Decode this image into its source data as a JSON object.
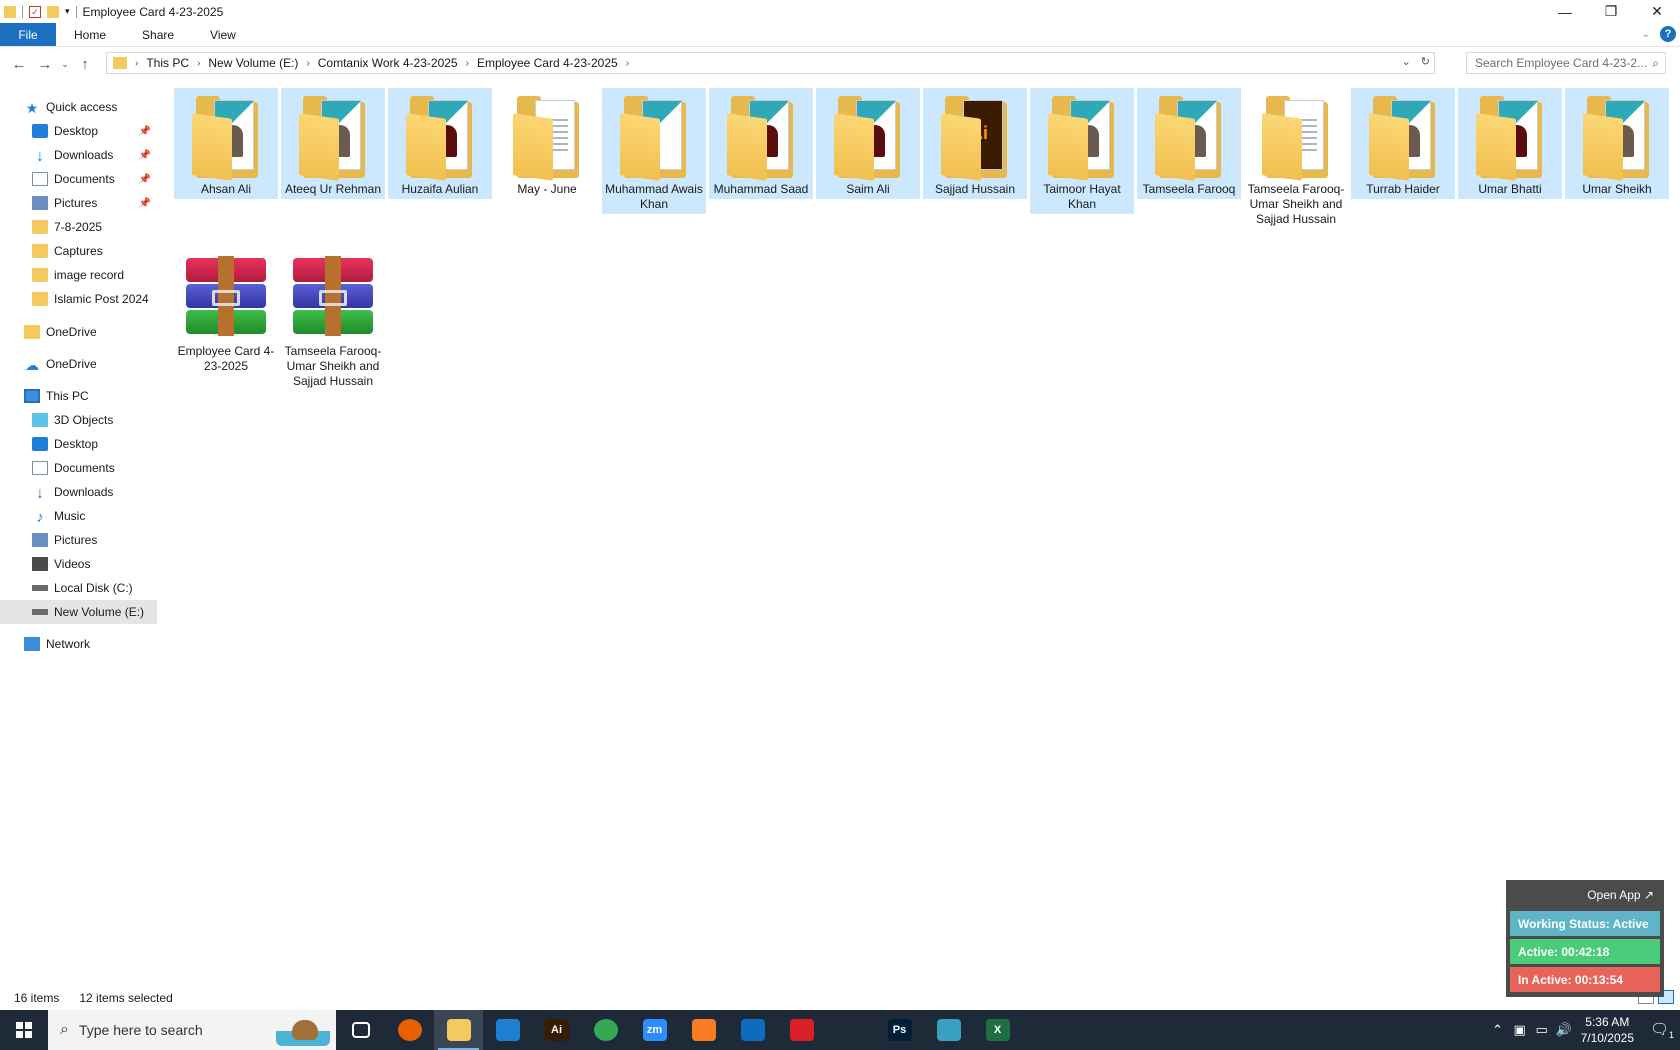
{
  "window": {
    "title": "Employee Card 4-23-2025",
    "minimize_glyph": "—",
    "restore_glyph": "❐",
    "close_glyph": "✕"
  },
  "ribbon": {
    "tabs": [
      "File",
      "Home",
      "Share",
      "View"
    ],
    "help": "?"
  },
  "address": {
    "crumbs": [
      "This PC",
      "New Volume (E:)",
      "Comtanix Work 4-23-2025",
      "Employee Card 4-23-2025"
    ],
    "search_placeholder": "Search Employee Card 4-23-2..."
  },
  "nav": {
    "quick_access": "Quick access",
    "quick_items": [
      "Desktop",
      "Downloads",
      "Documents",
      "Pictures",
      "7-8-2025",
      "Captures",
      "image record",
      "Islamic Post 2024"
    ],
    "onedrive_1": "OneDrive",
    "onedrive_2": "OneDrive",
    "this_pc": "This PC",
    "pc_items": [
      "3D Objects",
      "Desktop",
      "Documents",
      "Downloads",
      "Music",
      "Pictures",
      "Videos",
      "Local Disk (C:)",
      "New Volume (E:)"
    ],
    "network": "Network"
  },
  "items": [
    {
      "name": "Ahsan Ali",
      "kind": "folder-photo",
      "selected": true
    },
    {
      "name": "Ateeq Ur Rehman",
      "kind": "folder-photo",
      "selected": true
    },
    {
      "name": "Huzaifa Aulian",
      "kind": "folder-dark",
      "selected": true
    },
    {
      "name": "May - June",
      "kind": "folder-doc",
      "selected": false
    },
    {
      "name": "Muhammad Awais Khan",
      "kind": "folder-card",
      "selected": true
    },
    {
      "name": "Muhammad Saad",
      "kind": "folder-dark",
      "selected": true
    },
    {
      "name": "Saim Ali",
      "kind": "folder-dark",
      "selected": true
    },
    {
      "name": "Sajjad Hussain",
      "kind": "folder-ai",
      "selected": true
    },
    {
      "name": "Taimoor Hayat Khan",
      "kind": "folder-photo",
      "selected": true
    },
    {
      "name": "Tamseela Farooq",
      "kind": "folder-photo",
      "selected": true
    },
    {
      "name": "Tamseela Farooq- Umar Sheikh and Sajjad Hussain",
      "kind": "folder-doc",
      "selected": false
    },
    {
      "name": "Turrab Haider",
      "kind": "folder-photo",
      "selected": true
    },
    {
      "name": "Umar Bhatti",
      "kind": "folder-dark",
      "selected": true
    },
    {
      "name": "Umar Sheikh",
      "kind": "folder-photo",
      "selected": true
    },
    {
      "name": "Employee Card 4-23-2025",
      "kind": "rar",
      "selected": false
    },
    {
      "name": "Tamseela Farooq- Umar Sheikh and Sajjad Hussain",
      "kind": "rar",
      "selected": false
    }
  ],
  "status": {
    "count": "16 items",
    "selected": "12 items selected"
  },
  "widget": {
    "open_app": "Open App ↗",
    "working_status": "Working Status: Active",
    "active": "Active: 00:42:18",
    "inactive": "In Active: 00:13:54"
  },
  "taskbar": {
    "search_placeholder": "Type here to search",
    "apps": [
      {
        "name": "task-view",
        "label": "",
        "color": "#1f2a38"
      },
      {
        "name": "firefox",
        "label": "",
        "color": "#e66000"
      },
      {
        "name": "file-explorer",
        "label": "",
        "color": "#f4c95d"
      },
      {
        "name": "vscode",
        "label": "",
        "color": "#1f7fd0"
      },
      {
        "name": "illustrator",
        "label": "Ai",
        "color": "#3a1a00"
      },
      {
        "name": "chrome",
        "label": "",
        "color": "#34a853"
      },
      {
        "name": "zoom",
        "label": "zm",
        "color": "#2d8cff"
      },
      {
        "name": "xampp",
        "label": "",
        "color": "#fb7a24"
      },
      {
        "name": "outlook",
        "label": "",
        "color": "#0f6cbd"
      },
      {
        "name": "creative-cloud",
        "label": "",
        "color": "#da1f26"
      },
      {
        "name": "pen-tool",
        "label": "",
        "color": "#1f2a38"
      },
      {
        "name": "photoshop",
        "label": "Ps",
        "color": "#001e36"
      },
      {
        "name": "gem-app",
        "label": "",
        "color": "#3aa0c0"
      },
      {
        "name": "excel",
        "label": "X",
        "color": "#1d6f42"
      }
    ],
    "time": "5:36 AM",
    "date": "7/10/2025",
    "notif_count": "1"
  }
}
